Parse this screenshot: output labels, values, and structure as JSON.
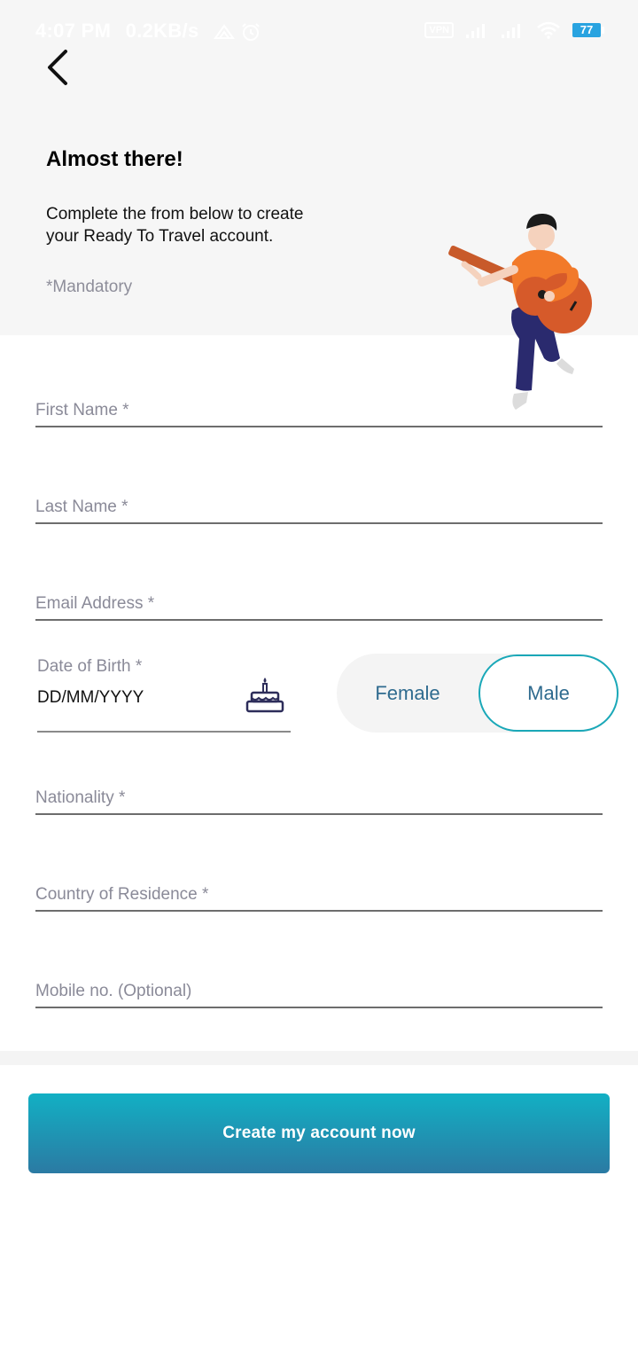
{
  "status_bar": {
    "time": "4:07 PM",
    "speed": "0.2KB/s",
    "vpn": "VPN",
    "battery": "77",
    "icons": [
      "hotspot-icon",
      "alarm-icon",
      "signal-icon",
      "signal-icon",
      "wifi-icon",
      "battery-icon"
    ]
  },
  "header": {
    "back_icon": "chevron-left-icon",
    "title": "Almost there!",
    "subtitle": "Complete the from below to create\n your Ready To Travel account.",
    "mandatory_note": "*Mandatory",
    "illustration": "person-playing-guitar"
  },
  "form": {
    "first_name": {
      "label": "First Name *"
    },
    "last_name": {
      "label": "Last Name *"
    },
    "email": {
      "label": "Email Address *"
    },
    "dob": {
      "label": "Date of Birth *",
      "placeholder": "DD/MM/YYYY",
      "icon": "birthday-cake-icon"
    },
    "gender": {
      "options": [
        "Female",
        "Male"
      ],
      "selected": "Male"
    },
    "nationality": {
      "label": "Nationality *"
    },
    "country": {
      "label": "Country of Residence *"
    },
    "mobile": {
      "label": "Mobile no. (Optional)"
    }
  },
  "cta": {
    "label": "Create my account now"
  },
  "colors": {
    "accent": "#1aa8b8",
    "button_top": "#12b0c4",
    "button_bottom": "#2b7aa3",
    "label_gray": "#8a8a98",
    "shirt_orange": "#f27a2a",
    "guitar": "#d65a2a",
    "pants": "#2a2a6e"
  }
}
